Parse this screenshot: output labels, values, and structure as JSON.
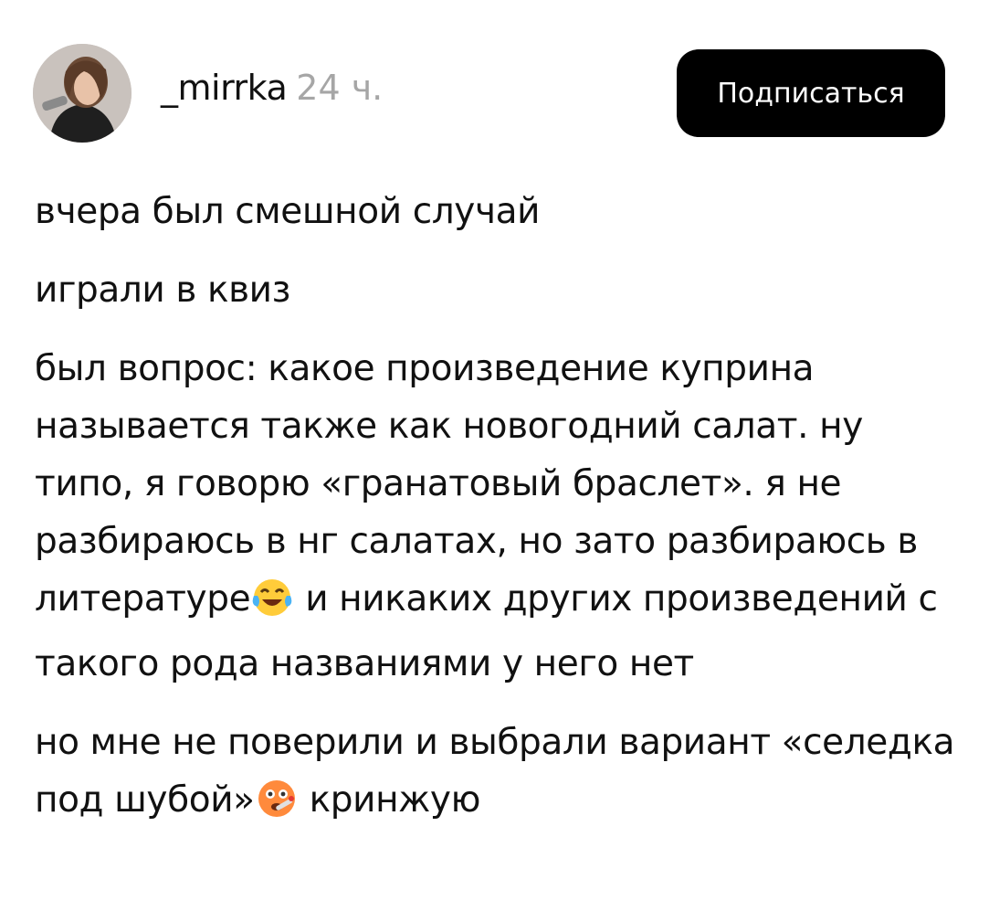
{
  "post": {
    "author": "_mirrka",
    "time": "24 ч.",
    "subscribe_label": "Подписаться",
    "paragraphs": {
      "p1": "вчера был смешной случай",
      "p2": "играли в квиз",
      "p3a": "был вопрос: какое произведение куприна называется также как новогодний салат. ну типо, я говорю «гранатовый браслет». я не разбираюсь в нг салатах, но зато разбираюсь в литературе",
      "p3b": " и никаких других произведений с такого рода названиями у него нет",
      "p4a": "но мне не поверили и выбрали вариант «селедка под шубой»",
      "p4b": " кринжую"
    },
    "icons": {
      "avatar": "avatar-photo",
      "emoji1": "tears-of-joy-emoji",
      "emoji2": "face-with-thermometer-emoji"
    }
  }
}
